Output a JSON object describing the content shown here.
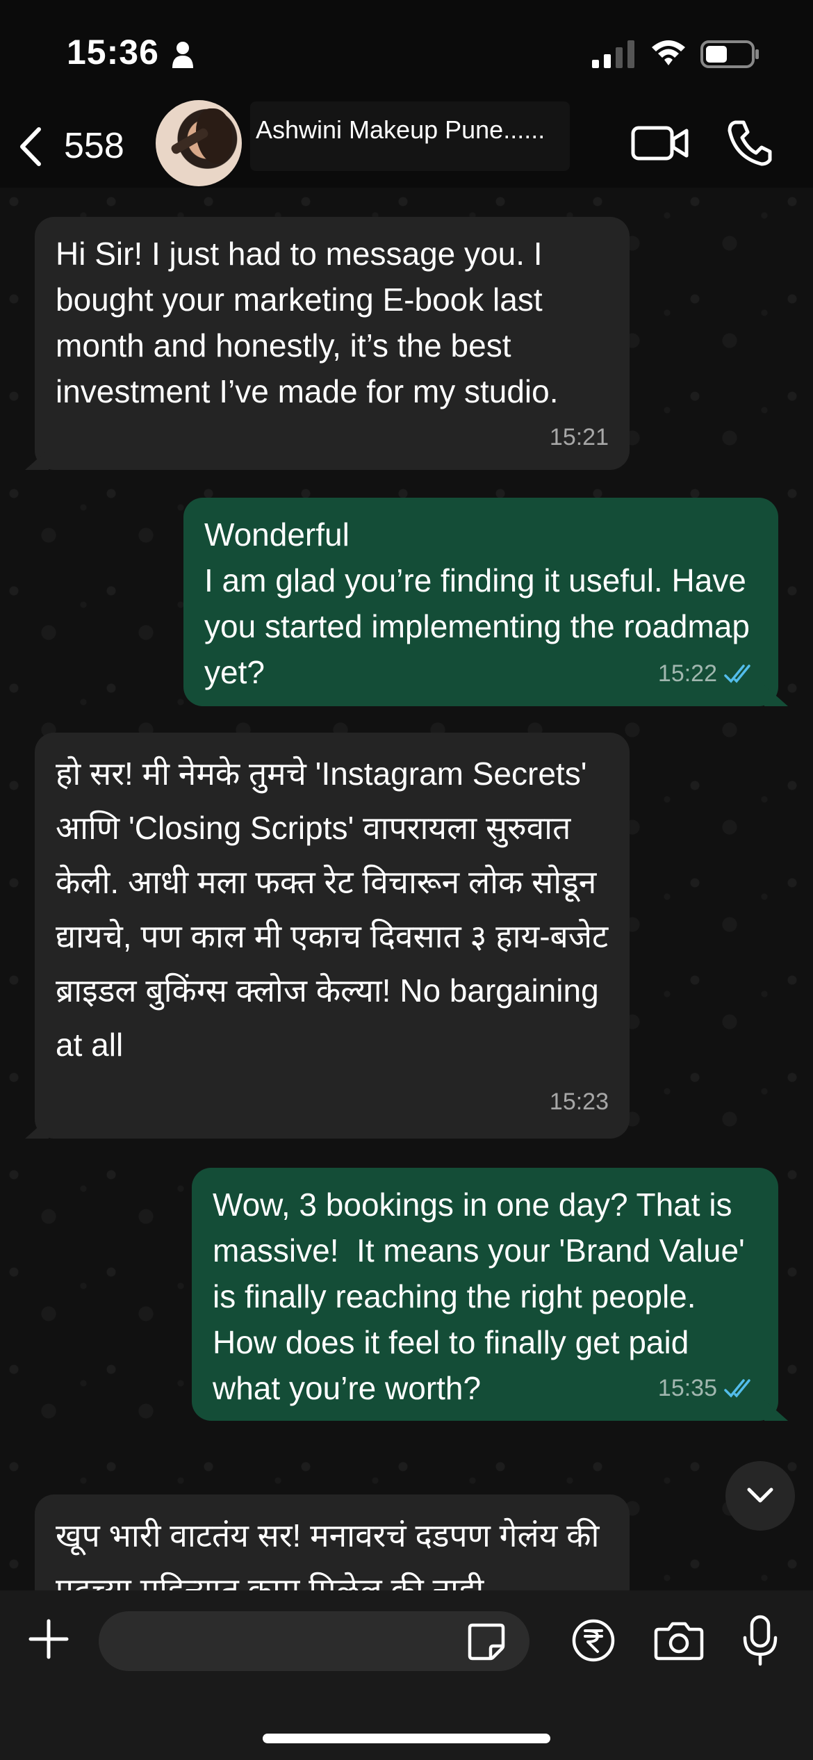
{
  "status_bar": {
    "time": "15:36"
  },
  "header": {
    "back_count": "558",
    "contact_name": "Ashwini Makeup Pune......"
  },
  "messages": [
    {
      "direction": "incoming",
      "text": "Hi Sir! I just had to message you. I bought your marketing E-book last month and honestly, it’s the best investment I’ve made for my studio.",
      "time": "15:21"
    },
    {
      "direction": "outgoing",
      "text": "Wonderful\nI am glad you’re finding it useful. Have you started implementing the roadmap yet?",
      "time": "15:22",
      "status": "read"
    },
    {
      "direction": "incoming",
      "text": "हो सर! मी नेमके तुमचे 'Instagram Secrets' आणि 'Closing Scripts' वापरायला सुरुवात केली. आधी मला फक्त रेट विचारून लोक सोडून द्यायचे, पण काल मी एकाच दिवसात ३ हाय-बजेट ब्राइडल बुकिंग्स क्लोज केल्या! No bargaining at all",
      "time": "15:23"
    },
    {
      "direction": "outgoing",
      "text": "Wow, 3 bookings in one day? That is massive!  It means your 'Brand Value' is finally reaching the right people. How does it feel to finally get paid what you’re worth?",
      "time": "15:35",
      "status": "read"
    },
    {
      "direction": "incoming",
      "text": "खूप भारी वाटतंय सर! मनावरचं दडपण गेलंय की पुढच्या महिन्यात काम मिळेल की नाही.",
      "time": ""
    }
  ],
  "composer": {
    "placeholder": ""
  },
  "colors": {
    "incoming_bubble": "#242424",
    "outgoing_bubble": "#144d37",
    "read_ticks": "#53bdeb"
  },
  "icons": [
    "person-icon",
    "signal-icon",
    "wifi-icon",
    "battery-icon",
    "back-chevron-icon",
    "video-call-icon",
    "voice-call-icon",
    "chevron-down-icon",
    "plus-icon",
    "sticker-icon",
    "rupee-payment-icon",
    "camera-icon",
    "microphone-icon"
  ]
}
